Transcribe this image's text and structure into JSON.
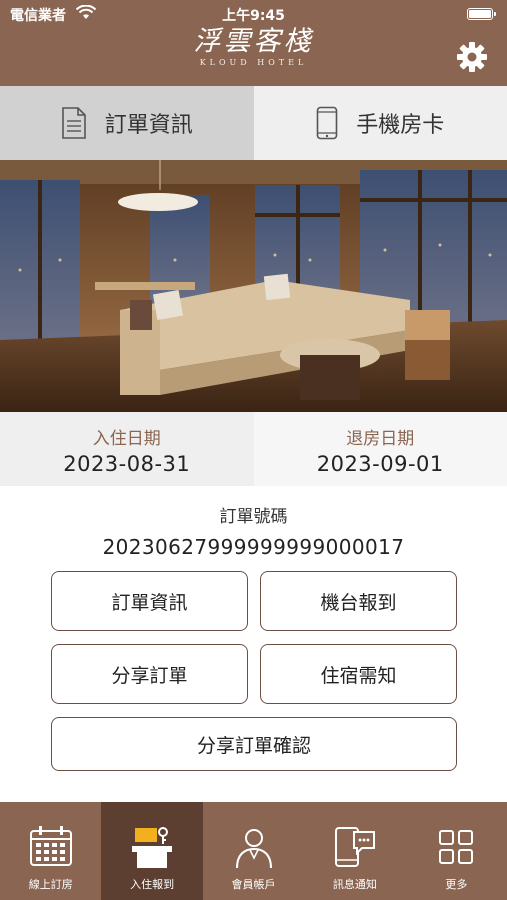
{
  "status_bar": {
    "carrier": "電信業者",
    "time": "上午9:45"
  },
  "header": {
    "logo_cn": "浮雲客棧",
    "logo_en": "KLOUD HOTEL"
  },
  "tabs": [
    {
      "label": "訂單資訊",
      "icon": "document-icon",
      "active": true
    },
    {
      "label": "手機房卡",
      "icon": "phone-icon",
      "active": false
    }
  ],
  "stay": {
    "checkin_label": "入住日期",
    "checkin_date": "2023-08-31",
    "checkout_label": "退房日期",
    "checkout_date": "2023-09-01"
  },
  "order": {
    "label": "訂單號碼",
    "number": "20230627999999999000017"
  },
  "actions": {
    "order_info": "訂單資訊",
    "kiosk_checkin": "機台報到",
    "share_order": "分享訂單",
    "stay_notice": "住宿需知",
    "share_confirm": "分享訂單確認"
  },
  "bottom_nav": [
    {
      "label": "線上訂房",
      "icon": "calendar-icon",
      "active": false
    },
    {
      "label": "入住報到",
      "icon": "front-desk-icon",
      "active": true
    },
    {
      "label": "會員帳戶",
      "icon": "member-icon",
      "active": false
    },
    {
      "label": "訊息通知",
      "icon": "message-icon",
      "active": false
    },
    {
      "label": "更多",
      "icon": "grid-icon",
      "active": false
    }
  ],
  "colors": {
    "brand": "#8a6551",
    "brand_dark": "#5c3f31",
    "tab_active": "#d1d1d1",
    "tab_inactive": "#efefef"
  }
}
